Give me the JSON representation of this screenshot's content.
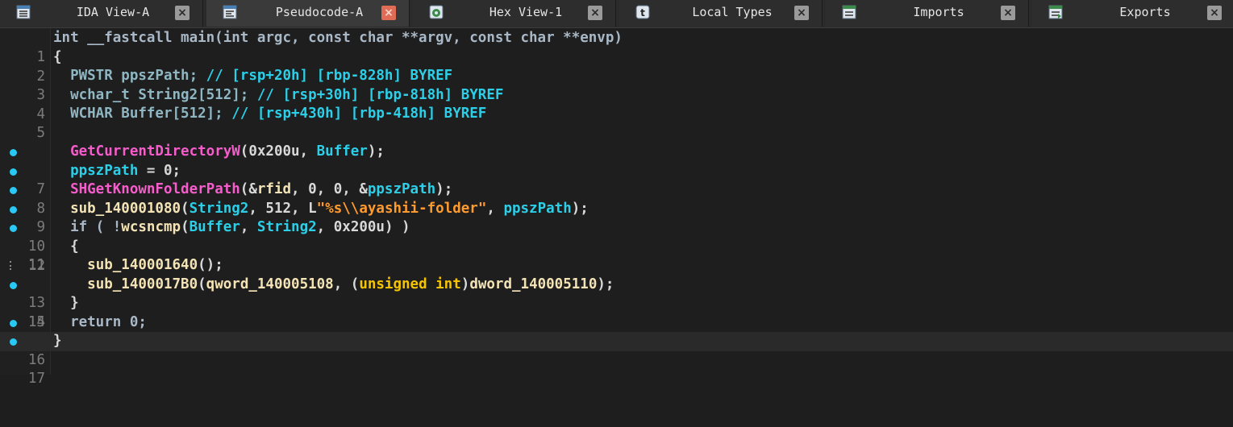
{
  "tabs": [
    {
      "label": "IDA View-A",
      "icon": "ida-view-icon",
      "active": false,
      "close": "×"
    },
    {
      "label": "Pseudocode-A",
      "icon": "pseudocode-icon",
      "active": true,
      "close": "×"
    },
    {
      "label": "Hex View-1",
      "icon": "hex-view-icon",
      "active": false,
      "close": "×"
    },
    {
      "label": "Local Types",
      "icon": "local-types-icon",
      "active": false,
      "close": "×"
    },
    {
      "label": "Imports",
      "icon": "imports-icon",
      "active": false,
      "close": "×"
    },
    {
      "label": "Exports",
      "icon": "exports-icon",
      "active": false,
      "close": "×"
    }
  ],
  "code": {
    "line1": {
      "num": "1",
      "text": "int __fastcall main(int argc, const char **argv, const char **envp)"
    },
    "line2": {
      "num": "2",
      "text": "{"
    },
    "line3": {
      "num": "3",
      "a": "  PWSTR ppszPath; ",
      "b": "// [rsp+20h] [rbp-828h] BYREF"
    },
    "line4": {
      "num": "4",
      "a": "  wchar_t String2[512]; ",
      "b": "// [rsp+30h] [rbp-818h] BYREF"
    },
    "line5": {
      "num": "5",
      "a": "  WCHAR Buffer[512]; ",
      "b": "// [rsp+430h] [rbp-418h] BYREF"
    },
    "line7": {
      "num": "7",
      "a": "GetCurrentDirectoryW",
      "b": "(0x200u, ",
      "c": "Buffer",
      "d": ");"
    },
    "line8": {
      "num": "8",
      "a": "ppszPath",
      "b": " = 0;"
    },
    "line9": {
      "num": "9",
      "a": "SHGetKnownFolderPath",
      "b": "(&",
      "c": "rfid",
      "d": ", 0, 0, &",
      "e": "ppszPath",
      "f": ");"
    },
    "line10": {
      "num": "10",
      "a": "sub_140001080",
      "b": "(",
      "c": "String2",
      "d": ", 512, L",
      "e": "\"%s\\\\ayashii-folder\"",
      "f": ", ",
      "g": "ppszPath",
      "h": ");"
    },
    "line11": {
      "num": "11",
      "a": "if ( !",
      "b": "wcsncmp",
      "c": "(",
      "d": "Buffer",
      "e": ", ",
      "f": "String2",
      "g": ", 0x200u) )"
    },
    "line12": {
      "num": "12",
      "text": "{"
    },
    "line13": {
      "num": "13",
      "a": "sub_140001640",
      "b": "();"
    },
    "line14": {
      "num": "14",
      "a": "sub_1400017B0",
      "b": "(",
      "c": "qword_140005108",
      "d": ", (",
      "e": "unsigned int",
      "f": ")",
      "g": "dword_140005110",
      "h": ");"
    },
    "line15": {
      "num": "15",
      "text": "}"
    },
    "line16": {
      "num": "16",
      "text": "return 0;"
    },
    "line17": {
      "num": "17",
      "text": "}"
    }
  }
}
